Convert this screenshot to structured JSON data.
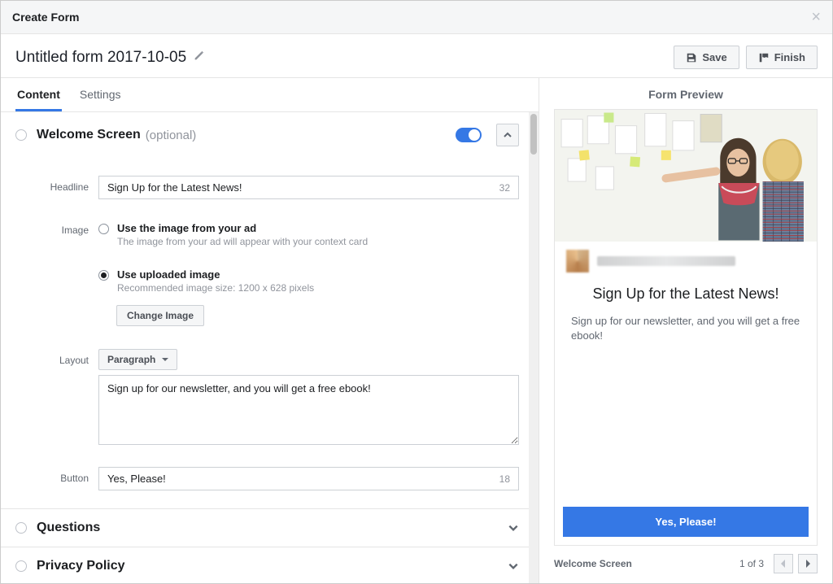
{
  "modal": {
    "title": "Create Form",
    "formName": "Untitled form 2017-10-05",
    "saveLabel": "Save",
    "finishLabel": "Finish"
  },
  "tabs": [
    {
      "label": "Content",
      "active": true
    },
    {
      "label": "Settings",
      "active": false
    }
  ],
  "sections": {
    "welcome": {
      "title": "Welcome Screen",
      "optional": "(optional)",
      "fields": {
        "headlineLabel": "Headline",
        "headlineValue": "Sign Up for the Latest News!",
        "headlineCount": "32",
        "imageLabel": "Image",
        "imageOptions": [
          {
            "label": "Use the image from your ad",
            "hint": "The image from your ad will appear with your context card",
            "selected": false
          },
          {
            "label": "Use uploaded image",
            "hint": "Recommended image size: 1200 x 628 pixels",
            "selected": true
          }
        ],
        "changeImageLabel": "Change Image",
        "layoutLabel": "Layout",
        "layoutSelected": "Paragraph",
        "paragraphValue": "Sign up for our newsletter, and you will get a free ebook!",
        "buttonLabel": "Button",
        "buttonValue": "Yes, Please!",
        "buttonCount": "18"
      }
    },
    "questions": {
      "title": "Questions"
    },
    "privacy": {
      "title": "Privacy Policy"
    }
  },
  "preview": {
    "panelTitle": "Form Preview",
    "headline": "Sign Up for the Latest News!",
    "description": "Sign up for our newsletter, and you will get a free ebook!",
    "cta": "Yes, Please!",
    "footerLabel": "Welcome Screen",
    "pageCount": "1 of 3"
  }
}
